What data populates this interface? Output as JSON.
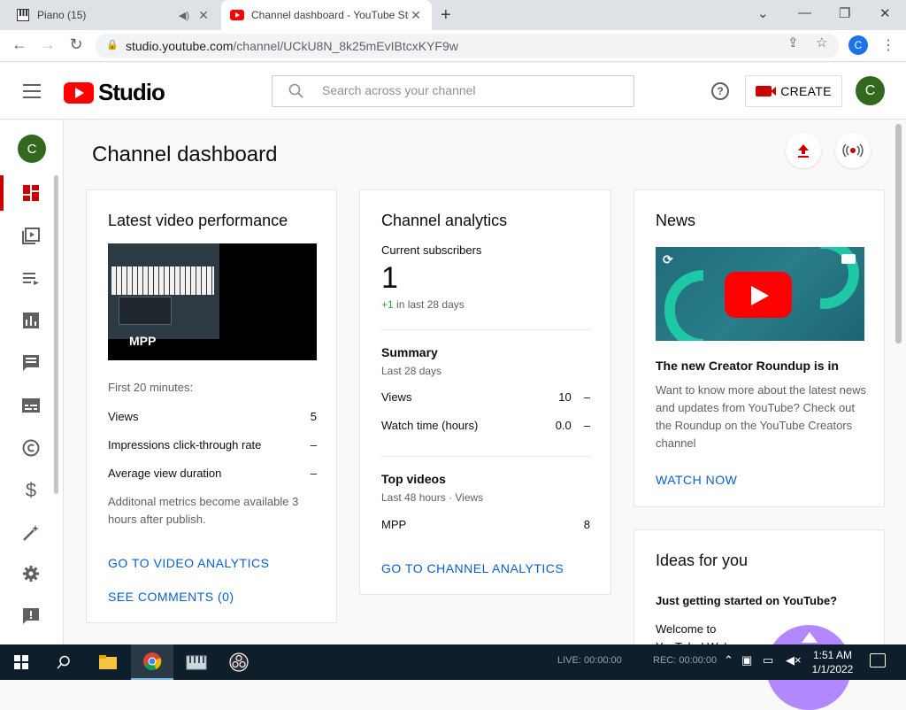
{
  "browser": {
    "tabs": [
      {
        "title": "Piano (15)"
      },
      {
        "title": "Channel dashboard - YouTube Studio"
      }
    ],
    "url_host": "studio.youtube.com",
    "url_path": "/channel/UCkU8N_8k25mEvIBtcxKYF9w",
    "profile_initial": "C"
  },
  "header": {
    "logo_text": "Studio",
    "search_placeholder": "Search across your channel",
    "create_label": "CREATE",
    "avatar_initial": "C"
  },
  "rail": {
    "avatar_initial": "C",
    "items": [
      {
        "icon": "dashboard-icon",
        "active": true
      },
      {
        "icon": "content-icon"
      },
      {
        "icon": "playlists-icon"
      },
      {
        "icon": "analytics-icon"
      },
      {
        "icon": "comments-icon"
      },
      {
        "icon": "subtitles-icon"
      },
      {
        "icon": "copyright-icon"
      },
      {
        "icon": "monetization-icon"
      },
      {
        "icon": "customization-icon"
      },
      {
        "icon": "settings-icon"
      },
      {
        "icon": "feedback-icon"
      }
    ]
  },
  "page": {
    "title": "Channel dashboard"
  },
  "latest_video": {
    "heading": "Latest video performance",
    "thumbnail_label": "MPP",
    "window_label": "First 20 minutes:",
    "metrics": [
      {
        "name": "Views",
        "value": "5"
      },
      {
        "name": "Impressions click-through rate",
        "value": "–"
      },
      {
        "name": "Average view duration",
        "value": "–"
      }
    ],
    "note": "Additonal metrics become available 3 hours after publish.",
    "analytics_link": "GO TO VIDEO ANALYTICS",
    "comments_link": "SEE COMMENTS (0)"
  },
  "channel_analytics": {
    "heading": "Channel analytics",
    "subs_label": "Current subscribers",
    "subs_value": "1",
    "subs_change_value": "+1",
    "subs_change_label": "in last 28 days",
    "summary_title": "Summary",
    "summary_period": "Last 28 days",
    "summary_rows": [
      {
        "name": "Views",
        "value": "10",
        "trend": "–"
      },
      {
        "name": "Watch time (hours)",
        "value": "0.0",
        "trend": "–"
      }
    ],
    "top_title": "Top videos",
    "top_period": "Last 48 hours · Views",
    "top_rows": [
      {
        "name": "MPP",
        "value": "8"
      }
    ],
    "link": "GO TO CHANNEL ANALYTICS"
  },
  "news": {
    "heading": "News",
    "title": "The new Creator Roundup is in",
    "body": "Want to know more about the latest news and updates from YouTube? Check out the Roundup on the YouTube Creators channel",
    "link": "WATCH NOW"
  },
  "ideas": {
    "heading": "Ideas for you",
    "subheading": "Just getting started on YouTube?",
    "body": "Welcome to YouTube! We've"
  },
  "taskbar": {
    "time": "1:51 AM",
    "date": "1/1/2022",
    "live_label": "LIVE: 00:00:00",
    "rec_label": "REC: 00:00:00"
  },
  "colors": {
    "accent_red": "#cc0000",
    "link_blue": "#065fd4",
    "avatar_green": "#33691e"
  }
}
